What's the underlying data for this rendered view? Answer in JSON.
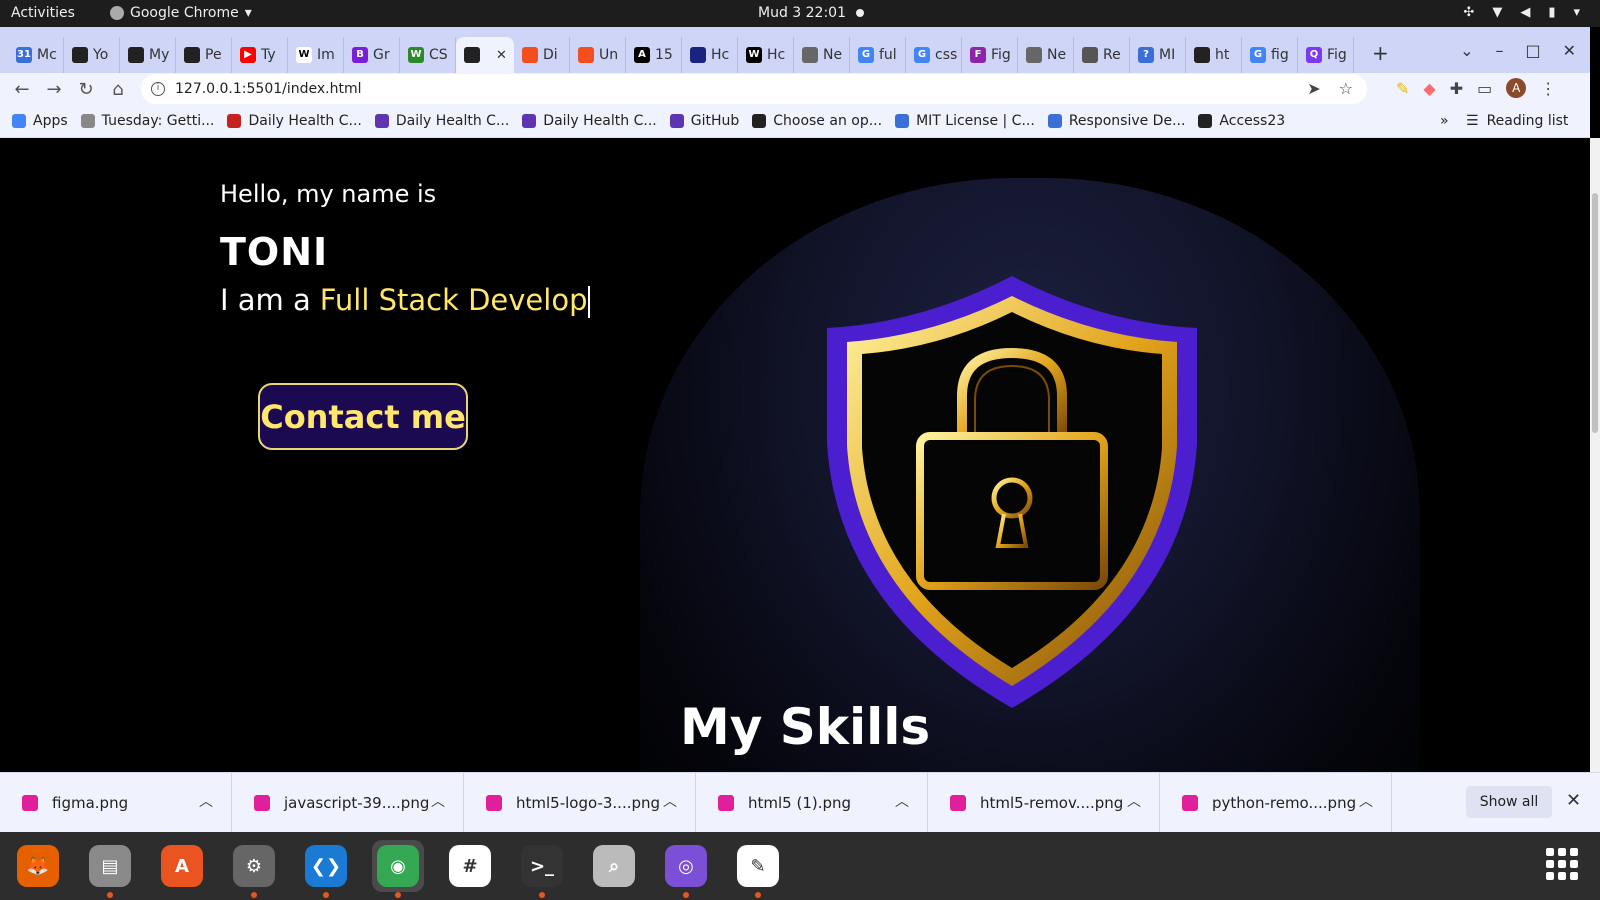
{
  "topbar": {
    "activities": "Activities",
    "app": "Google Chrome",
    "datetime": "Mud 3  22:01"
  },
  "tabs": [
    {
      "label": "Mc",
      "color": "#3b6fd8",
      "glyph": "31"
    },
    {
      "label": "Yo",
      "color": "#222222",
      "glyph": ""
    },
    {
      "label": "My",
      "color": "#222222",
      "glyph": ""
    },
    {
      "label": "Pe",
      "color": "#222222",
      "glyph": ""
    },
    {
      "label": "Ty",
      "color": "#ff0000",
      "glyph": "▶"
    },
    {
      "label": "Im",
      "color": "#ffffff",
      "glyph": "W"
    },
    {
      "label": "Gr",
      "color": "#7a1fd6",
      "glyph": "B"
    },
    {
      "label": "CS",
      "color": "#2a8a2a",
      "glyph": "W"
    },
    {
      "label": "",
      "color": "#222222",
      "glyph": "",
      "active": true
    },
    {
      "label": "Di",
      "color": "#f24e1e",
      "glyph": ""
    },
    {
      "label": "Un",
      "color": "#f24e1e",
      "glyph": ""
    },
    {
      "label": "15",
      "color": "#000000",
      "glyph": "A"
    },
    {
      "label": "Hc",
      "color": "#1a237e",
      "glyph": ""
    },
    {
      "label": "Hc",
      "color": "#000000",
      "glyph": "W"
    },
    {
      "label": "Ne",
      "color": "#666666",
      "glyph": ""
    },
    {
      "label": "ful",
      "color": "#4285f4",
      "glyph": "G"
    },
    {
      "label": "css",
      "color": "#4285f4",
      "glyph": "G"
    },
    {
      "label": "Fig",
      "color": "#8e24aa",
      "glyph": "F"
    },
    {
      "label": "Ne",
      "color": "#666666",
      "glyph": ""
    },
    {
      "label": "Re",
      "color": "#555555",
      "glyph": ""
    },
    {
      "label": "MI",
      "color": "#3b6fd8",
      "glyph": "?"
    },
    {
      "label": "ht",
      "color": "#222222",
      "glyph": ""
    },
    {
      "label": "fig",
      "color": "#4285f4",
      "glyph": "G"
    },
    {
      "label": "Fig",
      "color": "#7c3aed",
      "glyph": "Q"
    }
  ],
  "address": {
    "url": "127.0.0.1:5501/index.html"
  },
  "bookmarks": [
    {
      "label": "Apps"
    },
    {
      "label": "Tuesday: Getti..."
    },
    {
      "label": "Daily Health C..."
    },
    {
      "label": "Daily Health C..."
    },
    {
      "label": "Daily Health C..."
    },
    {
      "label": "GitHub"
    },
    {
      "label": "Choose an op..."
    },
    {
      "label": "MIT License | C..."
    },
    {
      "label": "Responsive De..."
    },
    {
      "label": "Access23"
    }
  ],
  "bookmarks_more": "»",
  "reading_list": "Reading list",
  "hero": {
    "greeting": "Hello, my name is",
    "name": "TONI",
    "role_prefix": "I am a",
    "role_typed": "Full Stack Develop",
    "contact_button": "Contact me",
    "skills_heading": "My Skills"
  },
  "downloads": [
    {
      "name": "figma.png"
    },
    {
      "name": "javascript-39....png"
    },
    {
      "name": "html5-logo-3....png"
    },
    {
      "name": "html5 (1).png"
    },
    {
      "name": "html5-remov....png"
    },
    {
      "name": "python-remo....png"
    }
  ],
  "show_all": "Show all",
  "dock": [
    {
      "name": "firefox",
      "color": "#e66000"
    },
    {
      "name": "files",
      "color": "#8a8a8a"
    },
    {
      "name": "software",
      "color": "#e95420"
    },
    {
      "name": "settings",
      "color": "#666666"
    },
    {
      "name": "vscode",
      "color": "#1a7ad4"
    },
    {
      "name": "chrome",
      "color": "#34a853"
    },
    {
      "name": "slack",
      "color": "#ffffff"
    },
    {
      "name": "terminal",
      "color": "#333333"
    },
    {
      "name": "image-viewer",
      "color": "#bbbbbb"
    },
    {
      "name": "network",
      "color": "#7b4fd6"
    },
    {
      "name": "text-editor",
      "color": "#ffffff"
    }
  ]
}
